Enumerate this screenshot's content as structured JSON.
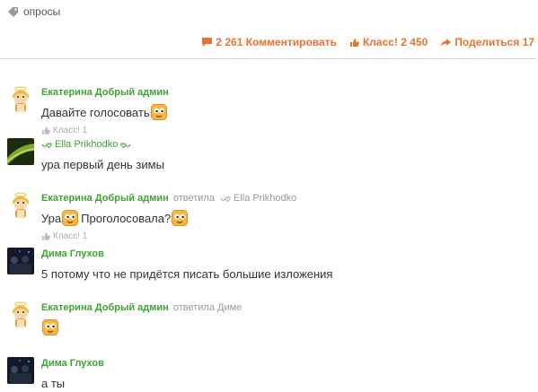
{
  "tag": {
    "label": "опросы",
    "icon": "tag-icon"
  },
  "actions": {
    "comments": {
      "icon": "comment-icon",
      "label": "2 261 Комментировать"
    },
    "klass": {
      "icon": "thumbs-up-icon",
      "label": "Класс! 2 450"
    },
    "share": {
      "icon": "share-arrow-icon",
      "label": "Поделиться 17"
    }
  },
  "comments": [
    {
      "author": "Екатерина Добрый админ",
      "avatar": "angel-avatar",
      "text": "Давайте голосовать",
      "smile": "smile-emoji",
      "klass": "Класс! 1"
    },
    {
      "author": "Ella Prikhodko",
      "avatar": "photo-avatar",
      "text": "ура первый день зимы"
    },
    {
      "author": "Екатерина Добрый админ",
      "avatar": "angel-avatar",
      "answered": "ответила",
      "target": "Ella Prikhodko",
      "text_a": "Ура",
      "text_b": "Проголосовала?",
      "klass": "Класс! 1"
    },
    {
      "author": "Дима Глухов",
      "avatar": "photo-avatar",
      "text": "5 потому что не придётся писать большие изложения"
    },
    {
      "author": "Екатерина Добрый админ",
      "avatar": "angel-avatar",
      "answered": "ответила Диме",
      "smile": "smile-emoji"
    },
    {
      "author": "Дима Глухов",
      "avatar": "photo-avatar",
      "text": "а ты"
    }
  ],
  "colors": {
    "accent": "#eb722e",
    "author": "#41a036",
    "muted": "#999999"
  }
}
